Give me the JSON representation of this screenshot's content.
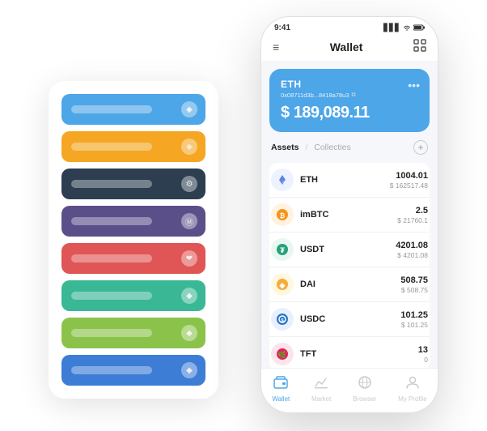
{
  "scene": {
    "background": "#ffffff"
  },
  "card_stack": {
    "cards": [
      {
        "color": "card-blue",
        "label": "",
        "icon": "◆"
      },
      {
        "color": "card-orange",
        "label": "",
        "icon": "◈"
      },
      {
        "color": "card-dark",
        "label": "",
        "icon": "⚙"
      },
      {
        "color": "card-purple",
        "label": "",
        "icon": "Ⓜ"
      },
      {
        "color": "card-red",
        "label": "",
        "icon": "❤"
      },
      {
        "color": "card-green",
        "label": "",
        "icon": "◆"
      },
      {
        "color": "card-light-green",
        "label": "",
        "icon": "◆"
      },
      {
        "color": "card-royal-blue",
        "label": "",
        "icon": "◆"
      }
    ]
  },
  "phone": {
    "status_bar": {
      "time": "9:41",
      "signal": "▋▋▋",
      "wifi": "wifi",
      "battery": "🔋"
    },
    "header": {
      "menu_icon": "≡",
      "title": "Wallet",
      "scan_icon": "⇌"
    },
    "balance_card": {
      "coin": "ETH",
      "address": "0x08711d3b...8418a78u3",
      "copy_icon": "⧉",
      "more_icon": "•••",
      "currency": "$",
      "amount": "189,089.11"
    },
    "assets_section": {
      "tab_active": "Assets",
      "tab_slash": "/",
      "tab_inactive": "Collecties",
      "add_icon": "+"
    },
    "assets": [
      {
        "ticker": "ETH",
        "icon_type": "eth",
        "icon_char": "◆",
        "amount": "1004.01",
        "usd": "$ 162517.48"
      },
      {
        "ticker": "imBTC",
        "icon_type": "imbtc",
        "icon_char": "₿",
        "amount": "2.5",
        "usd": "$ 21760.1"
      },
      {
        "ticker": "USDT",
        "icon_type": "usdt",
        "icon_char": "₮",
        "amount": "4201.08",
        "usd": "$ 4201.08"
      },
      {
        "ticker": "DAI",
        "icon_type": "dai",
        "icon_char": "◈",
        "amount": "508.75",
        "usd": "$ 508.75"
      },
      {
        "ticker": "USDC",
        "icon_type": "usdc",
        "icon_char": "⊙",
        "amount": "101.25",
        "usd": "$ 101.25"
      },
      {
        "ticker": "TFT",
        "icon_type": "tft",
        "icon_char": "🌿",
        "amount": "13",
        "usd": "0"
      }
    ],
    "bottom_nav": [
      {
        "label": "Wallet",
        "icon": "◎",
        "active": true
      },
      {
        "label": "Market",
        "icon": "📈",
        "active": false
      },
      {
        "label": "Browser",
        "icon": "🌐",
        "active": false
      },
      {
        "label": "My Profile",
        "icon": "👤",
        "active": false
      }
    ]
  }
}
